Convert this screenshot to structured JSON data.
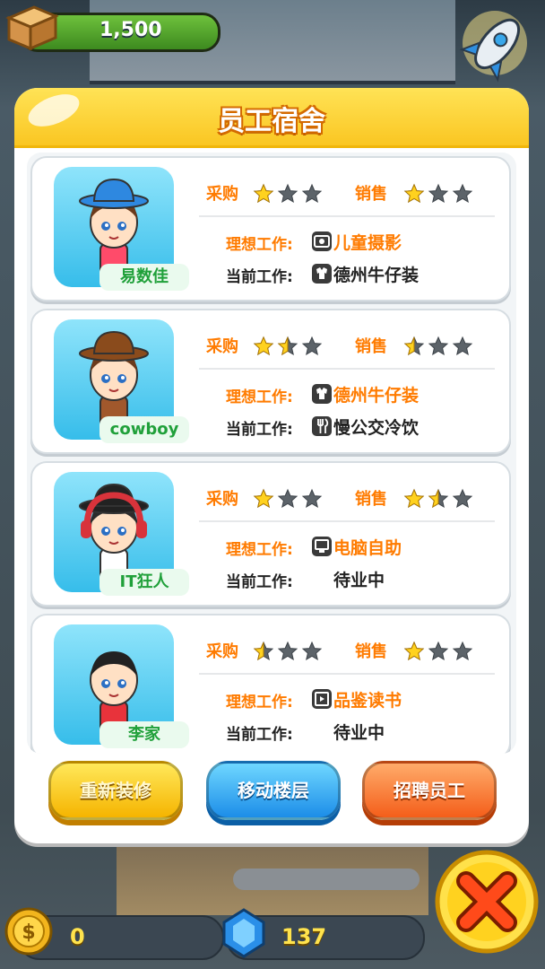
{
  "top": {
    "coins": "1,500"
  },
  "modal": {
    "title": "员工宿舍"
  },
  "labels": {
    "purchase": "采购",
    "sales": "销售",
    "ideal": "理想工作:",
    "current": "当前工作:"
  },
  "employees": [
    {
      "name": "易数佳",
      "purchase_stars": 1,
      "sales_stars": 1,
      "ideal_job": "儿童摄影",
      "ideal_icon": "camera-icon",
      "current_job": "德州牛仔装",
      "current_icon": "clothing-icon"
    },
    {
      "name": "cowboy",
      "purchase_stars": 1.5,
      "sales_stars": 0.5,
      "ideal_job": "德州牛仔装",
      "ideal_icon": "clothing-icon",
      "current_job": "慢公交冷饮",
      "current_icon": "fork-icon"
    },
    {
      "name": "IT狂人",
      "purchase_stars": 1,
      "sales_stars": 1.5,
      "ideal_job": "电脑自助",
      "ideal_icon": "computer-icon",
      "current_job": "待业中",
      "current_icon": ""
    },
    {
      "name": "李家",
      "purchase_stars": 0.5,
      "sales_stars": 1,
      "ideal_job": "品鉴读书",
      "ideal_icon": "book-icon",
      "current_job": "待业中",
      "current_icon": ""
    }
  ],
  "buttons": {
    "renovate": "重新装修",
    "move": "移动楼层",
    "hire": "招聘员工"
  },
  "bottom": {
    "coins": "0",
    "gems": "137"
  },
  "colors": {
    "title_bar": "#fac622",
    "label_orange": "#ff7b00",
    "name_green": "#20a03a"
  }
}
